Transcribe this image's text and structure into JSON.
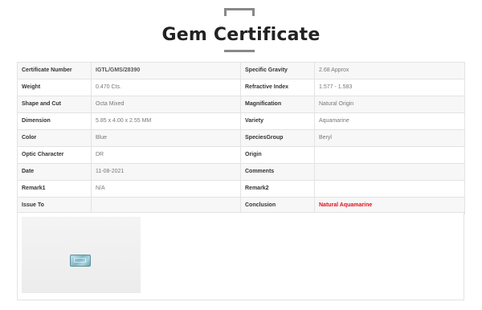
{
  "header": {
    "title": "Gem Certificate"
  },
  "table": {
    "rows": [
      {
        "label1": "Certificate Number",
        "value1": "IGTL/GMS/28390",
        "label2": "Specific Gravity",
        "value2": "2.68 Approx"
      },
      {
        "label1": "Weight",
        "value1": "0.470 Cts.",
        "label2": "Refractive Index",
        "value2": "1.577 - 1.583"
      },
      {
        "label1": "Shape and Cut",
        "value1": "Octa Mixed",
        "label2": "Magnification",
        "value2": "Natural Origin"
      },
      {
        "label1": "Dimension",
        "value1": "5.85 x 4.00 x 2.55 MM",
        "label2": "Variety",
        "value2": "Aquamarine"
      },
      {
        "label1": "Color",
        "value1": "Blue",
        "label2": "SpeciesGroup",
        "value2": "Beryl"
      },
      {
        "label1": "Optic Character",
        "value1": "DR",
        "label2": "Origin",
        "value2": ""
      },
      {
        "label1": "Date",
        "value1": "11-08-2021",
        "label2": "Comments",
        "value2": ""
      },
      {
        "label1": "Remark1",
        "value1": "N/A",
        "label2": "Remark2",
        "value2": ""
      },
      {
        "label1": "Issue To",
        "value1": "",
        "label2": "Conclusion",
        "value2": "Natural Aquamarine"
      }
    ],
    "highlight_color": "#e0111d"
  }
}
